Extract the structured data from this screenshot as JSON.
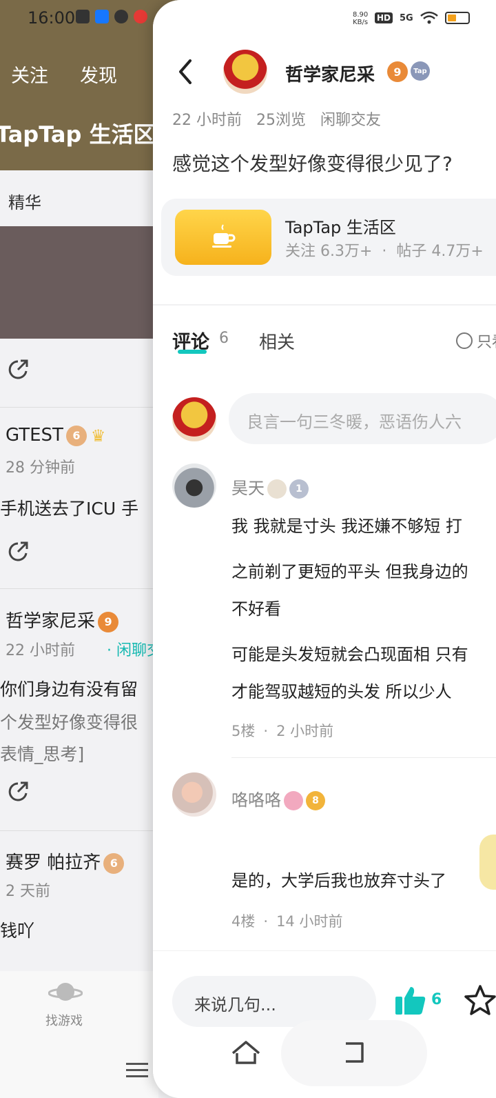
{
  "background_page": {
    "status_time": "16:00",
    "tabs": [
      "关注",
      "发现"
    ],
    "forum_title": "TapTap 生活区",
    "sub_tab": "精华",
    "posts": [
      {
        "author": "GTEST",
        "level": "6",
        "time": "28 分钟前",
        "text": "手机送去了ICU 手"
      },
      {
        "author": "哲学家尼采",
        "level": "9",
        "time": "22 小时前",
        "topic": "闲聊交",
        "title": "你们身边有没有留",
        "preview1": "个发型好像变得很",
        "preview2": "表情_思考]"
      },
      {
        "author": "赛罗 帕拉齐",
        "level": "6",
        "time": "2 天前",
        "text": "钱吖"
      }
    ],
    "bottom_nav": {
      "game_label": "找游戏"
    }
  },
  "status_bar": {
    "speed_value": "8.90",
    "speed_unit": "KB/s",
    "hd": "HD",
    "network": "5G"
  },
  "header": {
    "author_name": "哲学家尼采",
    "author_level": "9",
    "tap_badge": "Tap"
  },
  "post": {
    "meta": [
      "22 小时前",
      "25浏览",
      "闲聊交友"
    ],
    "text": "感觉这个发型好像变得很少见了?"
  },
  "forum_card": {
    "name": "TapTap 生活区",
    "followers_label": "关注 6.3万+",
    "separator": "·",
    "posts_label": "帖子 4.7万+"
  },
  "comment_tabs": {
    "comments_label": "评论",
    "comments_count": "6",
    "related_label": "相关",
    "only_author_label": "只看"
  },
  "comment_box": {
    "placeholder": "良言一句三冬暖，恶语伤人六"
  },
  "comments": [
    {
      "name": "昊天",
      "level": "1",
      "lines": [
        "我 我就是寸头  我还嫌不够短  打",
        "之前剃了更短的平头 但我身边的",
        "不好看",
        "可能是头发短就会凸现面相 只有",
        "才能驾驭越短的头发  所以少人"
      ],
      "floor": "5楼",
      "time": "2 小时前"
    },
    {
      "name": "咯咯咯",
      "level": "8",
      "lines": [
        "是的，大学后我也放弃寸头了"
      ],
      "floor": "4楼",
      "time": "14 小时前"
    }
  ],
  "bottom_bar": {
    "say_placeholder": "来说几句...",
    "like_count": "6"
  },
  "colors": {
    "accent": "#13c7be",
    "header_bg": "#7a6a48",
    "forum_icon": "#f6b21c"
  }
}
